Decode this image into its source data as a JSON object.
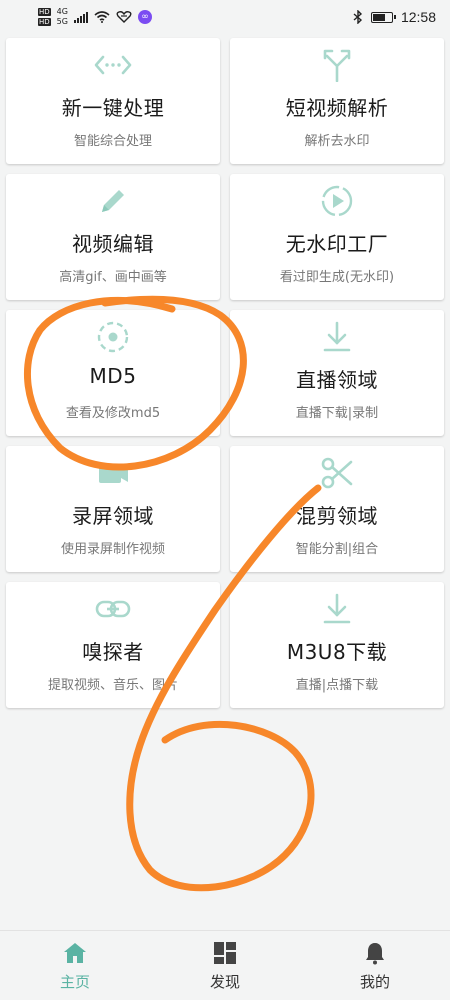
{
  "status_bar": {
    "hd_top": "HD",
    "hd_bottom": "HD",
    "net_4g": "4G",
    "net_5g": "5G",
    "app_badge": "∞",
    "time": "12:58",
    "icons": [
      "signal-bars-icon",
      "wifi-icon",
      "heart-icon",
      "app-icon",
      "bluetooth-icon",
      "battery-icon"
    ]
  },
  "colors": {
    "icon_tint": "#a9d8cc",
    "active_tab": "#5ab3a3",
    "scribble": "#f7872a"
  },
  "cards": [
    {
      "title": "新一键处理",
      "subtitle": "智能综合处理",
      "icon": "code-arrows-icon"
    },
    {
      "title": "短视频解析",
      "subtitle": "解析去水印",
      "icon": "merge-arrows-icon"
    },
    {
      "title": "视频编辑",
      "subtitle": "高清gif、画中画等",
      "icon": "pencil-icon"
    },
    {
      "title": "无水印工厂",
      "subtitle": "看过即生成(无水印)",
      "icon": "play-circle-icon"
    },
    {
      "title": "MD5",
      "subtitle": "查看及修改md5",
      "icon": "target-icon"
    },
    {
      "title": "直播领域",
      "subtitle": "直播下载|录制",
      "icon": "download-icon"
    },
    {
      "title": "录屏领域",
      "subtitle": "使用录屏制作视频",
      "icon": "screen-record-icon"
    },
    {
      "title": "混剪领域",
      "subtitle": "智能分割|组合",
      "icon": "scissors-icon"
    },
    {
      "title": "嗅探者",
      "subtitle": "提取视频、音乐、图片",
      "icon": "link-icon"
    },
    {
      "title": "M3U8下载",
      "subtitle": "直播|点播下载",
      "icon": "download-icon"
    }
  ],
  "tabs": [
    {
      "label": "主页",
      "icon": "home-icon",
      "active": true
    },
    {
      "label": "发现",
      "icon": "discover-grid-icon",
      "active": false
    },
    {
      "label": "我的",
      "icon": "bell-icon",
      "active": false
    }
  ]
}
